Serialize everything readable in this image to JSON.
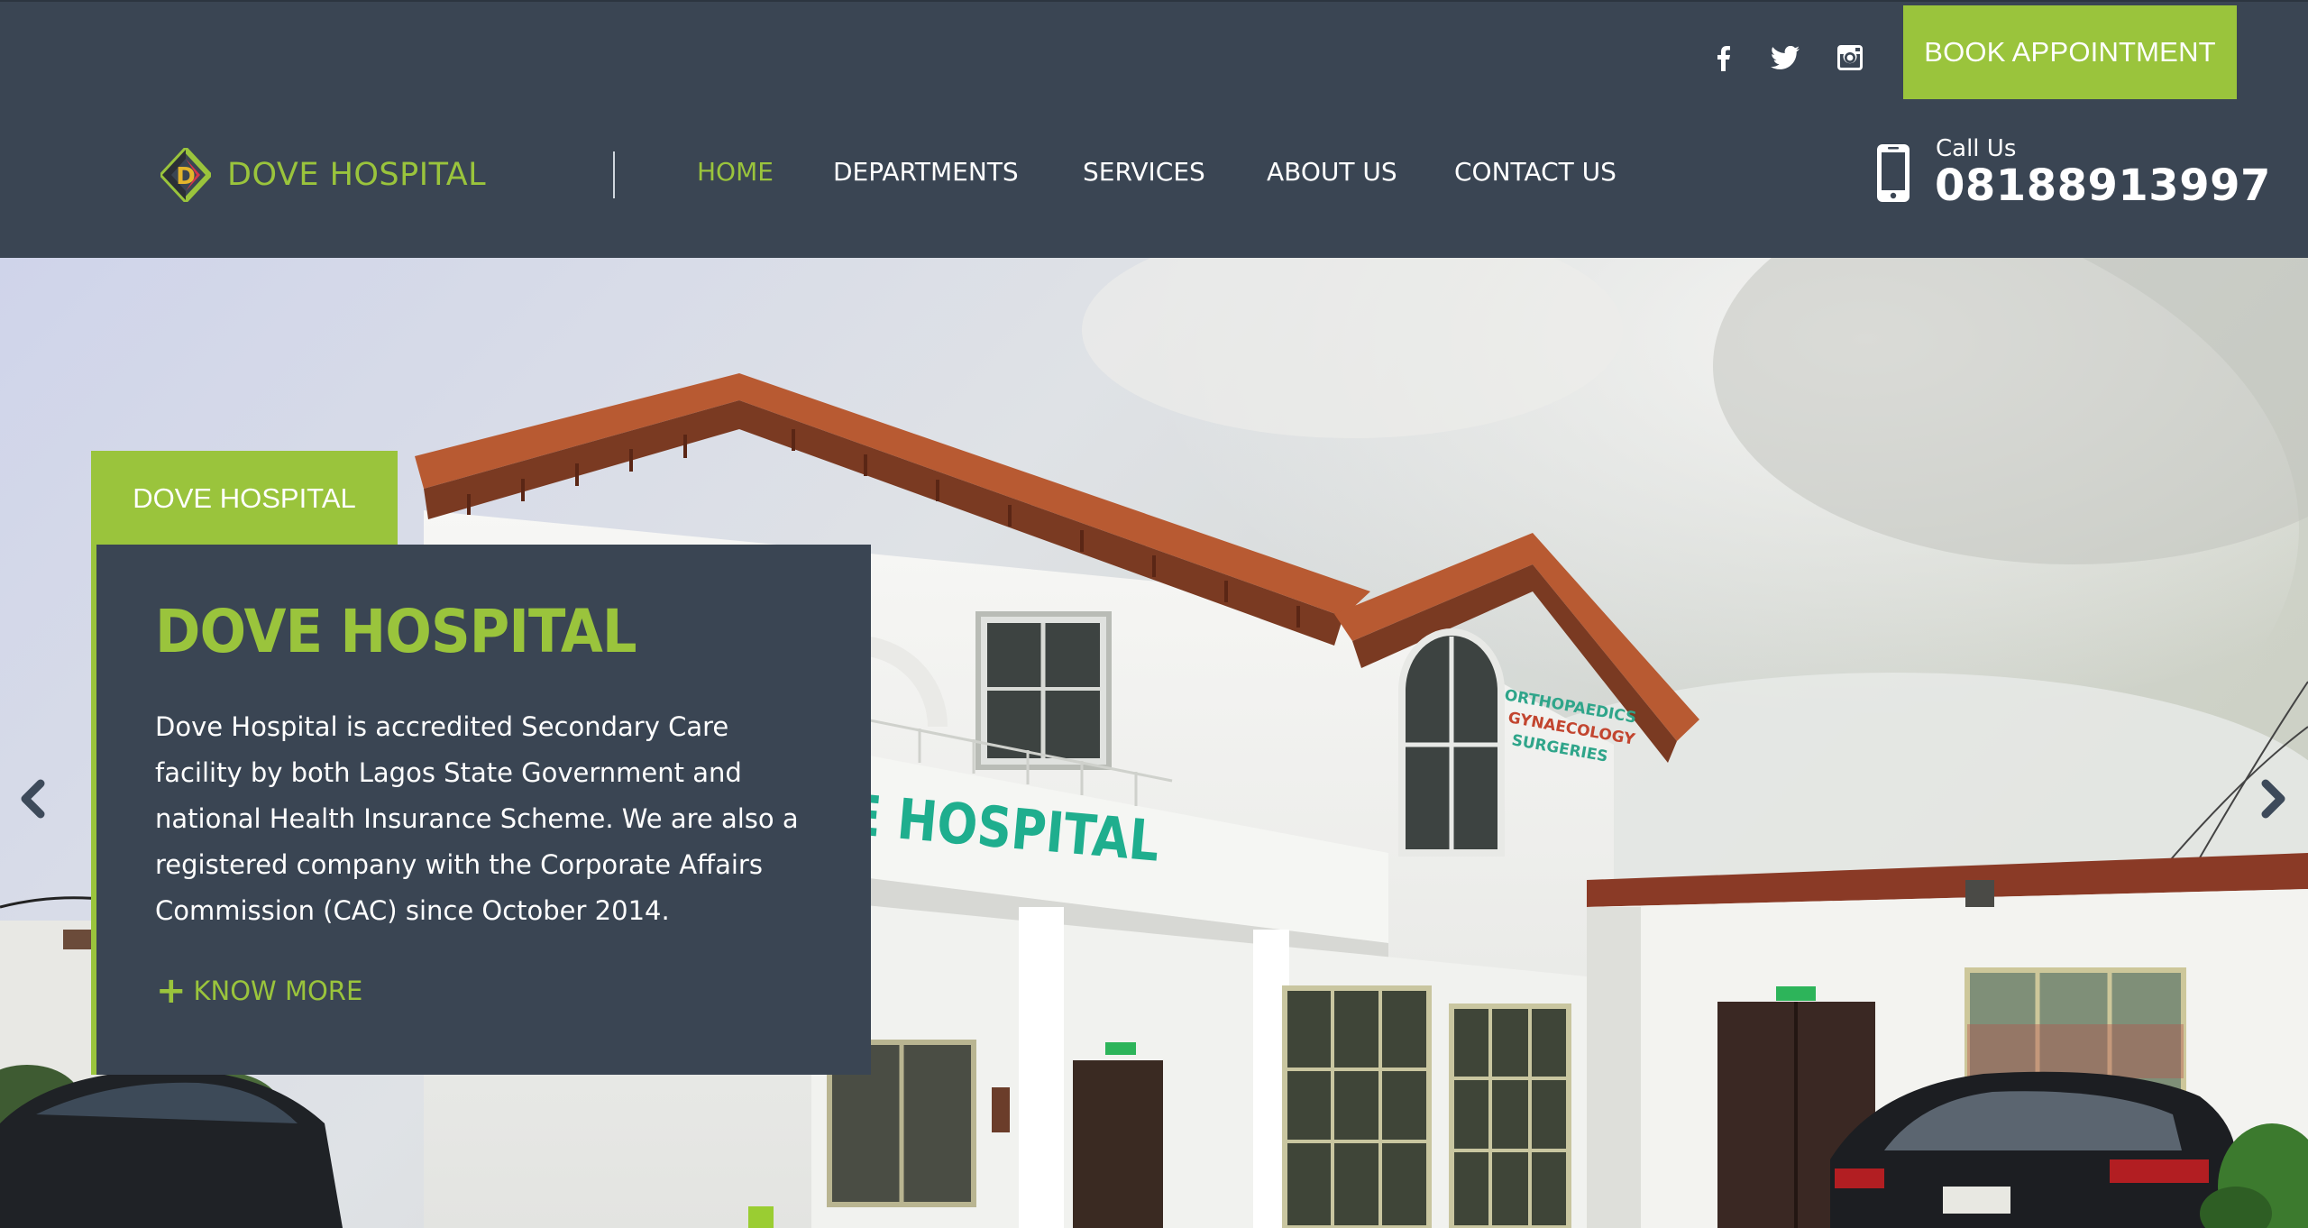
{
  "header": {
    "brand": "DOVE HOSPITAL",
    "book_button": "BOOK APPOINTMENT",
    "social": [
      "facebook-icon",
      "twitter-icon",
      "instagram-icon"
    ],
    "call_label": "Call Us",
    "call_number": "08188913997"
  },
  "nav": {
    "items": [
      "HOME",
      "DEPARTMENTS",
      "SERVICES",
      "ABOUT US",
      "CONTACT US"
    ],
    "active": "HOME"
  },
  "hero": {
    "tag": "DOVE HOSPITAL",
    "title": "DOVE HOSPITAL",
    "description": "Dove Hospital is accredited Secondary Care facility by both Lagos State Government and national Health Insurance Scheme. We are also a registered company with the Corporate Affairs Commission (CAC) since October 2014.",
    "cta": "KNOW MORE",
    "building_sign": "DOVE HOSPITAL",
    "side_sign": [
      "ORTHOPAEDICS",
      "GYNAECOLOGY",
      "SURGERIES"
    ]
  },
  "colors": {
    "header_bg": "#3a4553",
    "accent": "#9ac43c",
    "text": "#ffffff"
  }
}
